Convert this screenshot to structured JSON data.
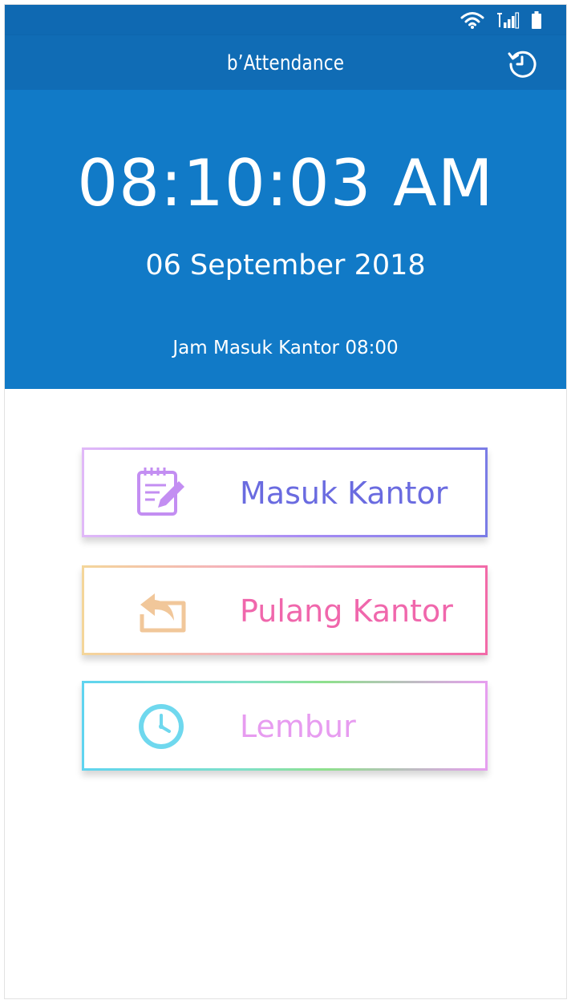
{
  "status_bar": {
    "icons": [
      "wifi-icon",
      "signal-icon",
      "battery-icon"
    ]
  },
  "app_bar": {
    "title": "b’Attendance",
    "action_icon": "history-icon"
  },
  "hero": {
    "time": "08:10:03 AM",
    "date": "06 September 2018",
    "office_hours": "Jam Masuk Kantor 08:00"
  },
  "actions": {
    "check_in": {
      "label": "Masuk Kantor",
      "icon": "notepad-edit-icon",
      "color": "#6a6be0"
    },
    "check_out": {
      "label": "Pulang Kantor",
      "icon": "return-arrow-icon",
      "color": "#f067ac"
    },
    "overtime": {
      "label": "Lembur",
      "icon": "clock-icon",
      "color": "#e79cf0"
    }
  },
  "colors": {
    "app_bar": "#106cb5",
    "hero": "#117ac7",
    "status_bar": "#0f69b2"
  }
}
